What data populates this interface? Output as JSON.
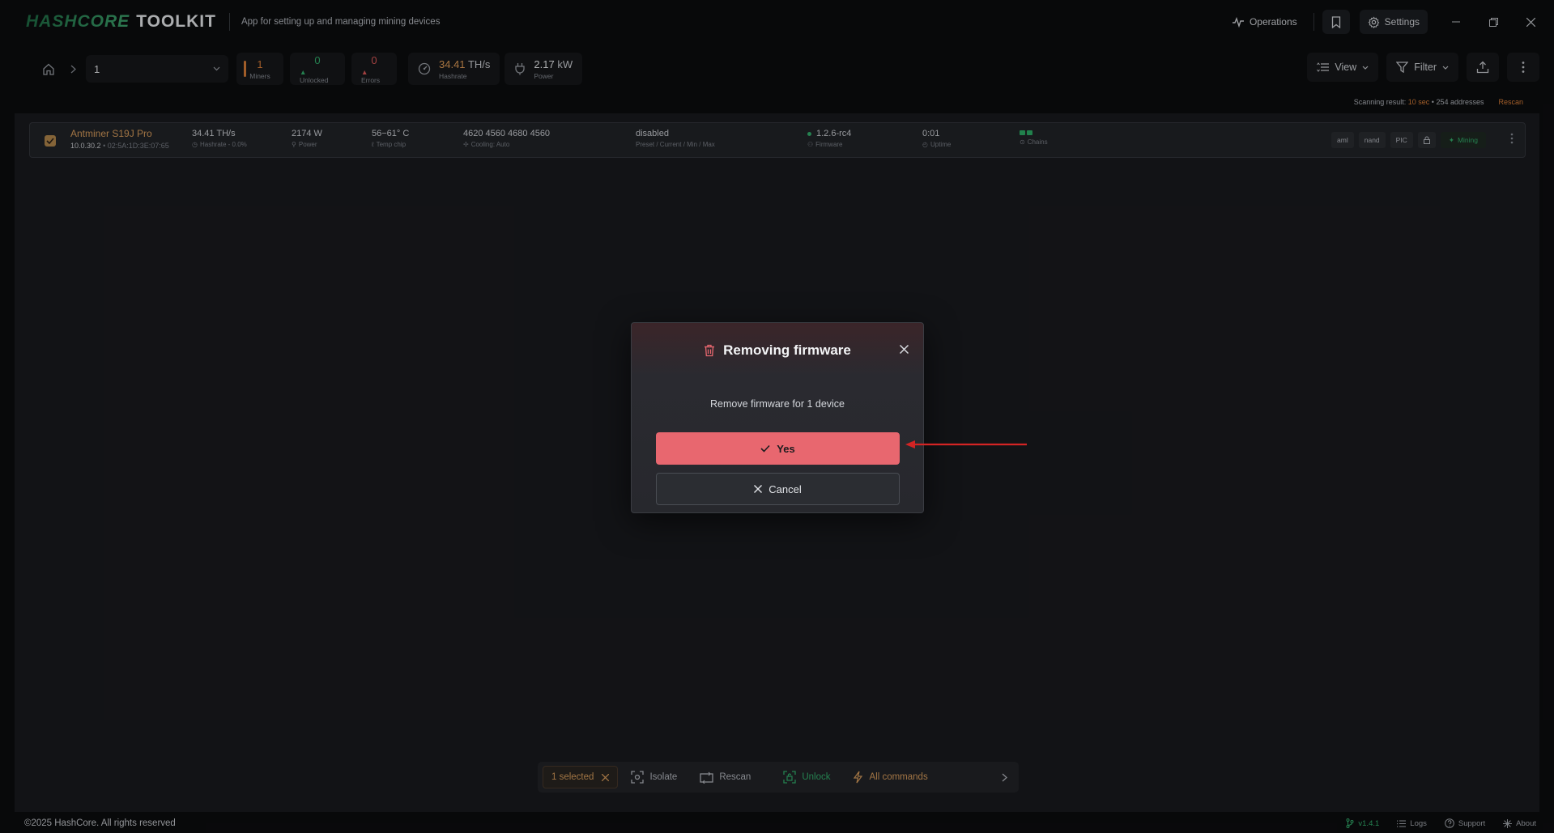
{
  "app": {
    "brand": "HASHCORE",
    "product": "TOOLKIT",
    "tagline": "App for setting up and managing mining devices"
  },
  "titlebar": {
    "operations_label": "Operations",
    "settings_label": "Settings"
  },
  "toolbar": {
    "group_value": "1",
    "stats": {
      "miners": {
        "value": "1",
        "label": "Miners"
      },
      "unlocked": {
        "value": "0",
        "label": "Unlocked"
      },
      "errors": {
        "value": "0",
        "label": "Errors"
      }
    },
    "hashrate": {
      "value": "34.41",
      "unit": "TH/s",
      "label": "Hashrate"
    },
    "power": {
      "value": "2.17",
      "unit": "kW",
      "label": "Power"
    },
    "view_label": "View",
    "filter_label": "Filter"
  },
  "scan": {
    "prefix": "Scanning result:",
    "duration": "10 sec",
    "addresses": "254 addresses",
    "rescan_label": "Rescan"
  },
  "device": {
    "name": "Antminer S19J Pro",
    "ip": "10.0.30.2",
    "mac": "02:5A:1D:3E:07:65",
    "hashrate": "34.41 TH/s",
    "hashrate_sub": "Hashrate - 0.0%",
    "power": "2174 W",
    "power_sub": "Power",
    "temp": "56−61° C",
    "temp_sub": "Temp chip",
    "fans": "4620 4560 4680 4560",
    "fans_sub": "Cooling: Auto",
    "preset": "disabled",
    "preset_sub": "Preset / Current / Min / Max",
    "firmware": "1.2.6-rc4",
    "firmware_sub": "Firmware",
    "uptime": "0:01",
    "uptime_sub": "Uptime",
    "chains_sub": "Chains",
    "tags": [
      "aml",
      "nand",
      "PIC"
    ],
    "status": "Mining"
  },
  "dialog": {
    "title": "Removing firmware",
    "message": "Remove firmware for 1 device",
    "yes_label": "Yes",
    "cancel_label": "Cancel"
  },
  "actionbar": {
    "selected_label": "1 selected",
    "isolate_label": "Isolate",
    "rescan_label": "Rescan",
    "unlock_label": "Unlock",
    "all_commands_label": "All commands"
  },
  "footer": {
    "copyright": "©2025 HashCore. All rights reserved",
    "version": "v1.4.1",
    "logs_label": "Logs",
    "support_label": "Support",
    "about_label": "About"
  },
  "colors": {
    "accent_orange": "#e0823a",
    "accent_green": "#34b36f",
    "danger": "#e8676f",
    "error_red": "#e25b5b",
    "background": "#0c0d0f",
    "panel": "#1a1b1f"
  },
  "icons": [
    "operations-pulse-icon",
    "bookmark-icon",
    "gear-icon",
    "minimize-icon",
    "restore-icon",
    "close-icon",
    "home-icon",
    "chevron-right-icon",
    "chevron-down-icon",
    "gauge-icon",
    "plug-icon",
    "list-view-icon",
    "filter-icon",
    "export-icon",
    "kebab-menu-icon",
    "check-icon",
    "trash-icon",
    "lock-icon",
    "isolate-icon",
    "rescan-icon",
    "unlock-icon",
    "lightning-icon",
    "branch-icon",
    "logs-icon",
    "help-icon",
    "about-icon"
  ]
}
